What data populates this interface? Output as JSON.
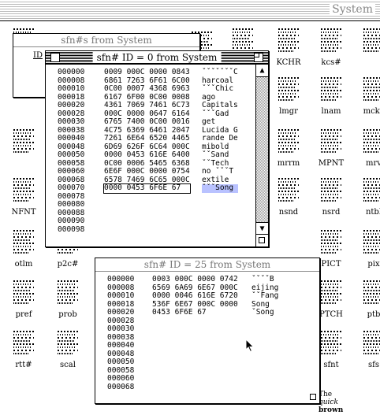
{
  "background_window": {
    "title": "System",
    "resource_types": [
      {
        "label": "KCHR"
      },
      {
        "label": "kcs#"
      },
      {
        "label": "lmgr"
      },
      {
        "label": "lnam"
      },
      {
        "label": "mcky"
      },
      {
        "label": "mrrm"
      },
      {
        "label": "MPNT"
      },
      {
        "label": "mrv"
      },
      {
        "label": "NFNT"
      },
      {
        "label": "nsnd"
      },
      {
        "label": "nsrd"
      },
      {
        "label": "ntbl"
      },
      {
        "label": "otlm"
      },
      {
        "label": "p2c#"
      },
      {
        "label": "PICT"
      },
      {
        "label": "pix"
      },
      {
        "label": "pref"
      },
      {
        "label": "prob"
      },
      {
        "label": "PTCH"
      },
      {
        "label": "ptb"
      },
      {
        "label": "rtt#"
      },
      {
        "label": "scal"
      },
      {
        "label": "sfnt"
      },
      {
        "label": "sfs"
      }
    ],
    "font_sample": {
      "line1": "The",
      "line2": "quick",
      "line3": "brown"
    }
  },
  "window_list": {
    "title": "sfn#s from System",
    "column_header": "ID"
  },
  "window_id0": {
    "title": "sfn# ID = 0 from System",
    "rows": [
      {
        "offset": "000000",
        "hex": "0009 000C 0000 0843",
        "ascii": "ˇˇˇˇˇˇˇC"
      },
      {
        "offset": "000008",
        "hex": "6861 7263 6F61 6C00",
        "ascii": "harcoal"
      },
      {
        "offset": "000010",
        "hex": "0C00 0007 4368 6963",
        "ascii": "ˇˇˇChic"
      },
      {
        "offset": "000018",
        "hex": "6167 6F00 0C00 0008",
        "ascii": "ago"
      },
      {
        "offset": "000020",
        "hex": "4361 7069 7461 6C73",
        "ascii": "Capitals"
      },
      {
        "offset": "000028",
        "hex": "000C 0000 0647 6164",
        "ascii": "ˇˇˇGad"
      },
      {
        "offset": "000030",
        "hex": "6765 7400 0C00 0016",
        "ascii": "get"
      },
      {
        "offset": "000038",
        "hex": "4C75 6369 6461 2047",
        "ascii": "Lucida G"
      },
      {
        "offset": "000040",
        "hex": "7261 6E64 6520 4465",
        "ascii": "rande De"
      },
      {
        "offset": "000048",
        "hex": "6D69 626F 6C64 000C",
        "ascii": "mibold"
      },
      {
        "offset": "000050",
        "hex": "0000 0453 616E 6400",
        "ascii": "ˇˇSand"
      },
      {
        "offset": "000058",
        "hex": "0C00 0006 5465 6368",
        "ascii": "ˇˇTech"
      },
      {
        "offset": "000060",
        "hex": "6E6F 000C 0000 0754",
        "ascii": "no ˇˇˇT"
      },
      {
        "offset": "000068",
        "hex": "6578 7469 6C65 000C",
        "ascii": "extile"
      },
      {
        "offset": "000070",
        "hex": "0000 0453 6F6E 67",
        "ascii": "ˇˇˇSong"
      },
      {
        "offset": "000078",
        "hex": "",
        "ascii": ""
      },
      {
        "offset": "000080",
        "hex": "",
        "ascii": ""
      },
      {
        "offset": "000088",
        "hex": "",
        "ascii": ""
      },
      {
        "offset": "000090",
        "hex": "",
        "ascii": ""
      },
      {
        "offset": "000098",
        "hex": "",
        "ascii": ""
      }
    ]
  },
  "window_id25": {
    "title": "sfn# ID = 25 from System",
    "rows": [
      {
        "offset": "000000",
        "hex": "0003 000C 0000 0742",
        "ascii": "ˇˇˇˇB"
      },
      {
        "offset": "000008",
        "hex": "6569 6A69 6E67 000C",
        "ascii": "eijing"
      },
      {
        "offset": "000010",
        "hex": "0000 0046 616E 6720",
        "ascii": "ˇˇFang"
      },
      {
        "offset": "000018",
        "hex": "536F 6E67 000C 0000",
        "ascii": "Song"
      },
      {
        "offset": "000020",
        "hex": "0453 6F6E 67",
        "ascii": "ˇSong"
      },
      {
        "offset": "000028",
        "hex": "",
        "ascii": ""
      },
      {
        "offset": "000030",
        "hex": "",
        "ascii": ""
      },
      {
        "offset": "000038",
        "hex": "",
        "ascii": ""
      },
      {
        "offset": "000040",
        "hex": "",
        "ascii": ""
      },
      {
        "offset": "000048",
        "hex": "",
        "ascii": ""
      },
      {
        "offset": "000050",
        "hex": "",
        "ascii": ""
      },
      {
        "offset": "000058",
        "hex": "",
        "ascii": ""
      },
      {
        "offset": "000060",
        "hex": "",
        "ascii": ""
      },
      {
        "offset": "000068",
        "hex": "",
        "ascii": ""
      }
    ]
  },
  "colors": {
    "selection": "#b9c2ff"
  }
}
